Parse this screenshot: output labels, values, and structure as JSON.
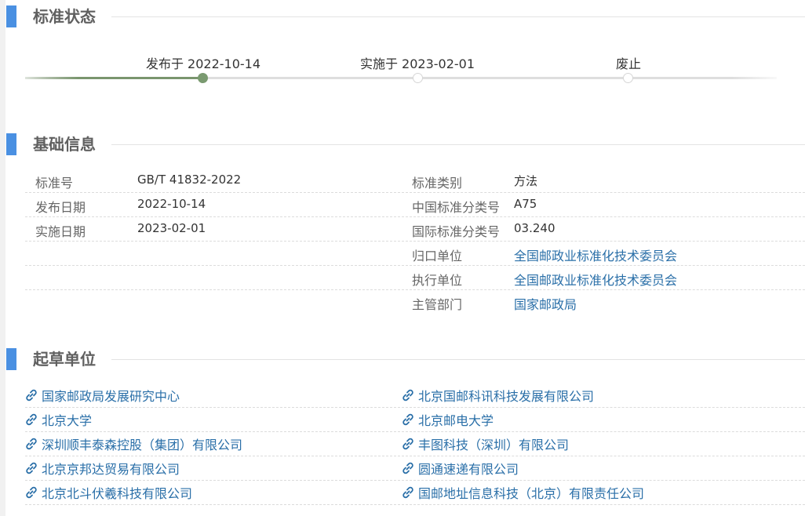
{
  "sections": {
    "status": "标准状态",
    "basic": "基础信息",
    "drafters": "起草单位"
  },
  "timeline": {
    "published": "发布于 2022-10-14",
    "implemented": "实施于 2023-02-01",
    "abolished": "废止",
    "current_stage": "published"
  },
  "basic_info": {
    "left": [
      {
        "label": "标准号",
        "value": "GB/T 41832-2022"
      },
      {
        "label": "发布日期",
        "value": "2022-10-14"
      },
      {
        "label": "实施日期",
        "value": "2023-02-01"
      }
    ],
    "right": [
      {
        "label": "标准类别",
        "value": "方法"
      },
      {
        "label": "中国标准分类号",
        "value": "A75"
      },
      {
        "label": "国际标准分类号",
        "value": "03.240"
      },
      {
        "label": "归口单位",
        "value": "全国邮政业标准化技术委员会"
      },
      {
        "label": "执行单位",
        "value": "全国邮政业标准化技术委员会"
      },
      {
        "label": "主管部门",
        "value": "国家邮政局"
      }
    ]
  },
  "drafting_units": [
    "国家邮政局发展研究中心",
    "北京国邮科讯科技发展有限公司",
    "北京大学",
    "北京邮电大学",
    "深圳顺丰泰森控股（集团）有限公司",
    "丰图科技（深圳）有限公司",
    "北京京邦达贸易有限公司",
    "圆通速递有限公司",
    "北京北斗伏羲科技有限公司",
    "国邮地址信息科技（北京）有限责任公司"
  ],
  "colors": {
    "accent_bar": "#4a90e2",
    "link": "#2a6fa8",
    "timeline_active": "#7a9a70"
  },
  "icons": {
    "link": "link-icon"
  }
}
